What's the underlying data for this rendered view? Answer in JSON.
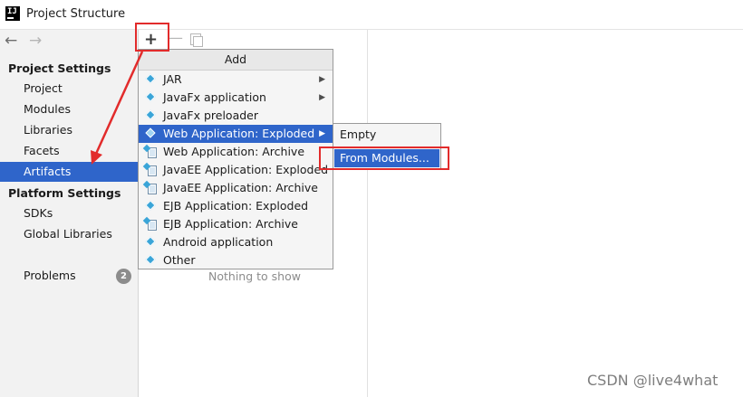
{
  "window": {
    "title": "Project Structure",
    "icon_text": "IJ"
  },
  "sidebar": {
    "project_settings_header": "Project Settings",
    "platform_settings_header": "Platform Settings",
    "items": [
      {
        "label": "Project"
      },
      {
        "label": "Modules"
      },
      {
        "label": "Libraries"
      },
      {
        "label": "Facets"
      },
      {
        "label": "Artifacts",
        "selected": true
      },
      {
        "label": "SDKs"
      },
      {
        "label": "Global Libraries"
      },
      {
        "label": "Problems",
        "badge": "2"
      }
    ]
  },
  "toolbar": {
    "add_icon": "+",
    "remove_icon": "—"
  },
  "add_menu": {
    "header": "Add",
    "items": [
      {
        "label": "JAR",
        "has_submenu": true
      },
      {
        "label": "JavaFx application",
        "has_submenu": true
      },
      {
        "label": "JavaFx preloader"
      },
      {
        "label": "Web Application: Exploded",
        "has_submenu": true,
        "highlighted": true
      },
      {
        "label": "Web Application: Archive"
      },
      {
        "label": "JavaEE Application: Exploded"
      },
      {
        "label": "JavaEE Application: Archive"
      },
      {
        "label": "EJB Application: Exploded"
      },
      {
        "label": "EJB Application: Archive"
      },
      {
        "label": "Android application"
      },
      {
        "label": "Other"
      }
    ]
  },
  "submenu": {
    "items": [
      {
        "label": "Empty"
      },
      {
        "label": "From Modules...",
        "highlighted": true
      }
    ]
  },
  "content": {
    "empty_text": "Nothing to show"
  },
  "watermark": "CSDN @live4what",
  "colors": {
    "selection": "#2f65ca",
    "annotation": "#e22b2b",
    "sidebar_bg": "#f2f2f2"
  }
}
